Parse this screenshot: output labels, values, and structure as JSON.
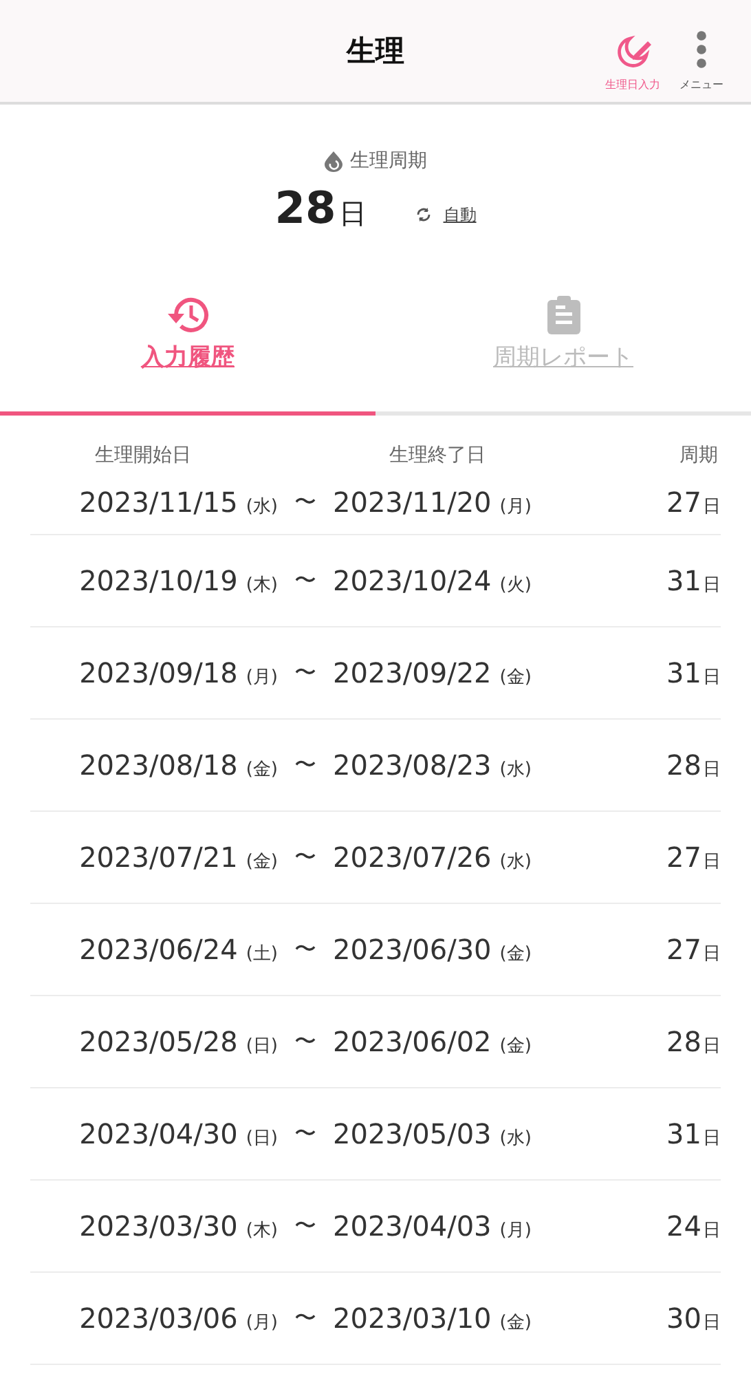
{
  "header": {
    "title": "生理",
    "actions": [
      {
        "kind": "entry",
        "label": "生理日入力"
      },
      {
        "kind": "menu",
        "label": "メニュー"
      }
    ]
  },
  "cycle": {
    "label": "生理周期",
    "value": "28",
    "unit": "日",
    "mode": "自動"
  },
  "tabs": [
    {
      "kind": "history",
      "label": "入力履歴",
      "selected": true
    },
    {
      "kind": "report",
      "label": "周期レポート",
      "selected": false
    }
  ],
  "table": {
    "columns": [
      "生理開始日",
      "生理終了日",
      "周期"
    ],
    "separator": "〜",
    "rows": [
      {
        "start": "2023/11/15",
        "start_day": "(水)",
        "end": "2023/11/20",
        "end_day": "(月)",
        "cycle": "27",
        "unit": "日"
      },
      {
        "start": "2023/10/19",
        "start_day": "(木)",
        "end": "2023/10/24",
        "end_day": "(火)",
        "cycle": "31",
        "unit": "日"
      },
      {
        "start": "2023/09/18",
        "start_day": "(月)",
        "end": "2023/09/22",
        "end_day": "(金)",
        "cycle": "31",
        "unit": "日"
      },
      {
        "start": "2023/08/18",
        "start_day": "(金)",
        "end": "2023/08/23",
        "end_day": "(水)",
        "cycle": "28",
        "unit": "日"
      },
      {
        "start": "2023/07/21",
        "start_day": "(金)",
        "end": "2023/07/26",
        "end_day": "(水)",
        "cycle": "27",
        "unit": "日"
      },
      {
        "start": "2023/06/24",
        "start_day": "(土)",
        "end": "2023/06/30",
        "end_day": "(金)",
        "cycle": "27",
        "unit": "日"
      },
      {
        "start": "2023/05/28",
        "start_day": "(日)",
        "end": "2023/06/02",
        "end_day": "(金)",
        "cycle": "28",
        "unit": "日"
      },
      {
        "start": "2023/04/30",
        "start_day": "(日)",
        "end": "2023/05/03",
        "end_day": "(水)",
        "cycle": "31",
        "unit": "日"
      },
      {
        "start": "2023/03/30",
        "start_day": "(木)",
        "end": "2023/04/03",
        "end_day": "(月)",
        "cycle": "24",
        "unit": "日"
      },
      {
        "start": "2023/03/06",
        "start_day": "(月)",
        "end": "2023/03/10",
        "end_day": "(金)",
        "cycle": "30",
        "unit": "日"
      }
    ]
  }
}
